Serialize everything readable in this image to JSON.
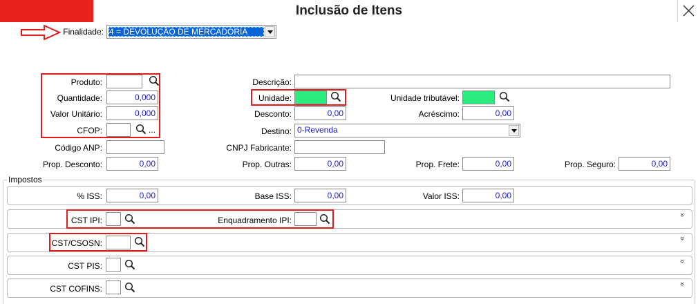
{
  "window": {
    "title": "Inclusão de Itens",
    "brand_color": "#e8231b"
  },
  "finalidade": {
    "label": "Finalidade:",
    "value": "4 = DEVOLUÇÃO DE MERCADORIA"
  },
  "produto": {
    "label": "Produto:",
    "value": ""
  },
  "quantidade": {
    "label": "Quantidade:",
    "value": "0,000"
  },
  "valor_unitario": {
    "label": "Valor Unitário:",
    "value": "0,000"
  },
  "cfop": {
    "label": "CFOP:",
    "value": "",
    "ellipsis": "..."
  },
  "codigo_anp": {
    "label": "Código ANP:",
    "value": ""
  },
  "prop_desconto": {
    "label": "Prop. Desconto:",
    "value": "0,00"
  },
  "descricao": {
    "label": "Descrição:",
    "value": ""
  },
  "unidade": {
    "label": "Unidade:",
    "value": ""
  },
  "unidade_tributavel": {
    "label": "Unidade tributável:",
    "value": ""
  },
  "desconto": {
    "label": "Desconto:",
    "value": "0,00"
  },
  "acrescimo": {
    "label": "Acréscimo:",
    "value": "0,00"
  },
  "destino": {
    "label": "Destino:",
    "value": "0-Revenda"
  },
  "cnpj_fabricante": {
    "label": "CNPJ Fabricante:",
    "value": ""
  },
  "prop_outras": {
    "label": "Prop. Outras:",
    "value": "0,00"
  },
  "prop_frete": {
    "label": "Prop. Frete:",
    "value": "0,00"
  },
  "prop_seguro": {
    "label": "Prop. Seguro:",
    "value": "0,00"
  },
  "impostos": {
    "title": "Impostos",
    "pct_iss": {
      "label": "% ISS:",
      "value": "0,00"
    },
    "base_iss": {
      "label": "Base ISS:",
      "value": "0,00"
    },
    "valor_iss": {
      "label": "Valor ISS:",
      "value": "0,00"
    },
    "cst_ipi": {
      "label": "CST IPI:",
      "value": ""
    },
    "enquadramento_ipi": {
      "label": "Enquadramento IPI:",
      "value": ""
    },
    "cst_csosn": {
      "label": "CST/CSOSN:",
      "value": ""
    },
    "cst_pis": {
      "label": "CST PIS:",
      "value": ""
    },
    "cst_cofins": {
      "label": "CST COFINS:",
      "value": ""
    },
    "expand_glyph": "»"
  }
}
